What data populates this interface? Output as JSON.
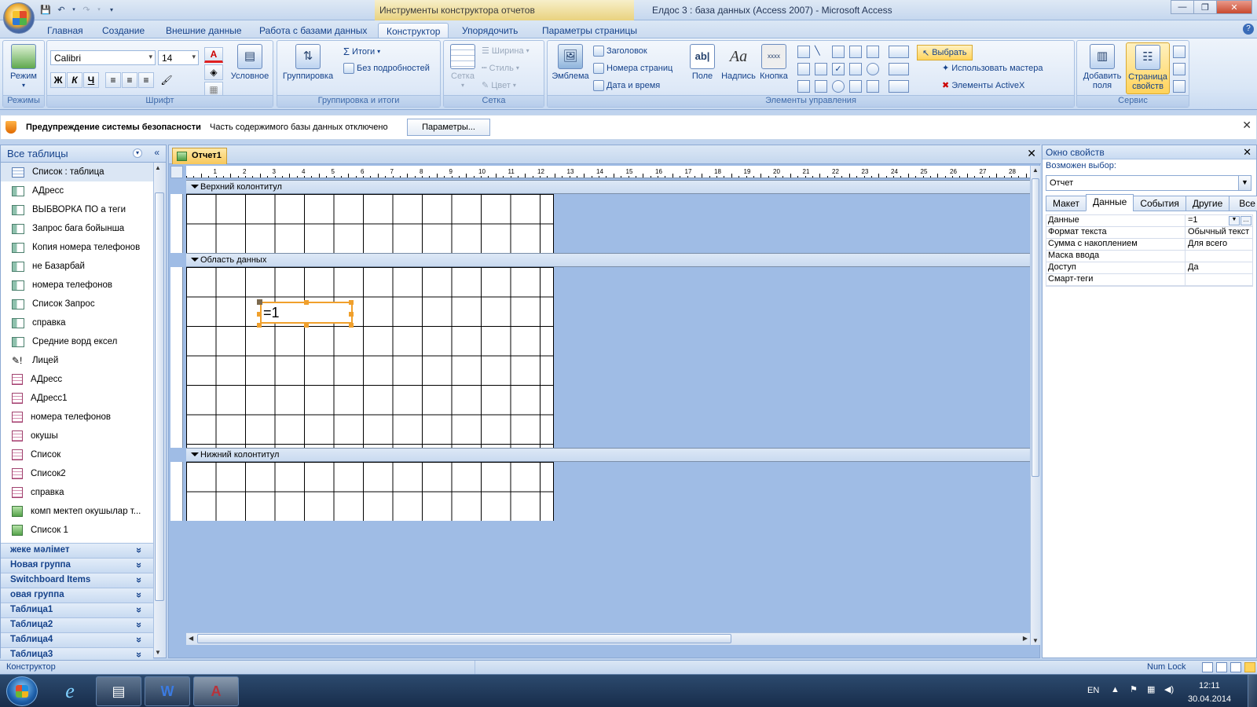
{
  "titlebar": {
    "context_tools": "Инструменты конструктора отчетов",
    "window_title": "Елдос 3 : база данных (Access 2007) - Microsoft Access"
  },
  "tabs": [
    "Главная",
    "Создание",
    "Внешние данные",
    "Работа с базами данных",
    "Конструктор",
    "Упорядочить",
    "Параметры страницы"
  ],
  "ribbon": {
    "mode_label": "Режим",
    "grp_modes": "Режимы",
    "font_name": "Calibri",
    "font_size": "14",
    "bold": "Ж",
    "italic": "К",
    "underline": "Ч",
    "conditional": "Условное",
    "grp_font": "Шрифт",
    "grouping": "Группировка",
    "totals": "Итоги",
    "hide_details": "Без подробностей",
    "grp_grouping": "Группировка и итоги",
    "grid": "Сетка",
    "width": "Ширина",
    "style": "Стиль",
    "color": "Цвет",
    "grp_grid": "Сетка",
    "logo": "Эмблема",
    "title_btn": "Заголовок",
    "page_numbers": "Номера страниц",
    "date_time": "Дата и время",
    "field": "Поле",
    "label": "Надпись",
    "button": "Кнопка",
    "button_icon_text": "xxxx",
    "select": "Выбрать",
    "use_wizard": "Использовать мастера",
    "activex": "Элементы ActiveX",
    "grp_controls": "Элементы управления",
    "add_fields_1": "Добавить",
    "add_fields_2": "поля",
    "prop_sheet_1": "Страница",
    "prop_sheet_2": "свойств",
    "grp_tools": "Сервис"
  },
  "message_bar": {
    "title": "Предупреждение системы безопасности",
    "text": "Часть содержимого базы данных отключено",
    "button": "Параметры..."
  },
  "nav": {
    "header": "Все таблицы",
    "items": [
      {
        "label": "Список : таблица",
        "icon": "table-icon"
      },
      {
        "label": "АДресс",
        "icon": "query-icon"
      },
      {
        "label": "ВЫБВОРКА  ПО а теги",
        "icon": "query-icon"
      },
      {
        "label": "Запрос бага бойынша",
        "icon": "query-icon"
      },
      {
        "label": "Копия номера телефонов",
        "icon": "query-icon"
      },
      {
        "label": "не Базарбай",
        "icon": "query-icon"
      },
      {
        "label": "номера телефонов",
        "icon": "query-icon"
      },
      {
        "label": "Список Запрос",
        "icon": "query-icon"
      },
      {
        "label": "справка",
        "icon": "query-icon"
      },
      {
        "label": "Средние ворд ексел",
        "icon": "query-icon"
      },
      {
        "label": "Лицей",
        "icon": "action-query-icon"
      },
      {
        "label": "АДресс",
        "icon": "report-icon"
      },
      {
        "label": "АДресс1",
        "icon": "report-icon"
      },
      {
        "label": "номера телефонов",
        "icon": "report-icon"
      },
      {
        "label": "окушы",
        "icon": "report-icon"
      },
      {
        "label": "Список",
        "icon": "report-icon"
      },
      {
        "label": "Список2",
        "icon": "report-icon"
      },
      {
        "label": "справка",
        "icon": "report-icon"
      },
      {
        "label": "комп мектеп окушылар т...",
        "icon": "form-icon"
      },
      {
        "label": "Список 1",
        "icon": "form-icon"
      }
    ],
    "groups": [
      "жеке мәлімет",
      "Новая группа",
      "Switchboard Items",
      "овая группа",
      "Таблица1",
      "Таблица2",
      "Таблица4",
      "Таблица3"
    ]
  },
  "document": {
    "tab": "Отчет1",
    "ruler_numbers": [
      "1",
      "2",
      "3",
      "4",
      "5",
      "6",
      "7",
      "8",
      "9",
      "10",
      "11",
      "12",
      "13",
      "14",
      "15",
      "16",
      "17",
      "18",
      "19",
      "20",
      "21",
      "22",
      "23",
      "24",
      "25",
      "26",
      "27",
      "28"
    ],
    "sections": {
      "header": "Верхний колонтитул",
      "detail": "Область данных",
      "footer": "Нижний колонтитул"
    },
    "textbox_value": "=1"
  },
  "props": {
    "title": "Окно свойств",
    "selection_label": "Возможен выбор:",
    "selection_value": "Отчет",
    "tabs": [
      "Макет",
      "Данные",
      "События",
      "Другие",
      "Все"
    ],
    "rows": [
      {
        "k": "Данные",
        "v": "=1"
      },
      {
        "k": "Формат текста",
        "v": "Обычный текст"
      },
      {
        "k": "Сумма с накоплением",
        "v": "Для всего"
      },
      {
        "k": "Маска ввода",
        "v": ""
      },
      {
        "k": "Доступ",
        "v": "Да"
      },
      {
        "k": "Смарт-теги",
        "v": ""
      }
    ]
  },
  "status": {
    "left": "Конструктор",
    "numlock": "Num Lock"
  },
  "taskbar": {
    "lang": "EN",
    "time": "12:11",
    "date": "30.04.2014"
  }
}
